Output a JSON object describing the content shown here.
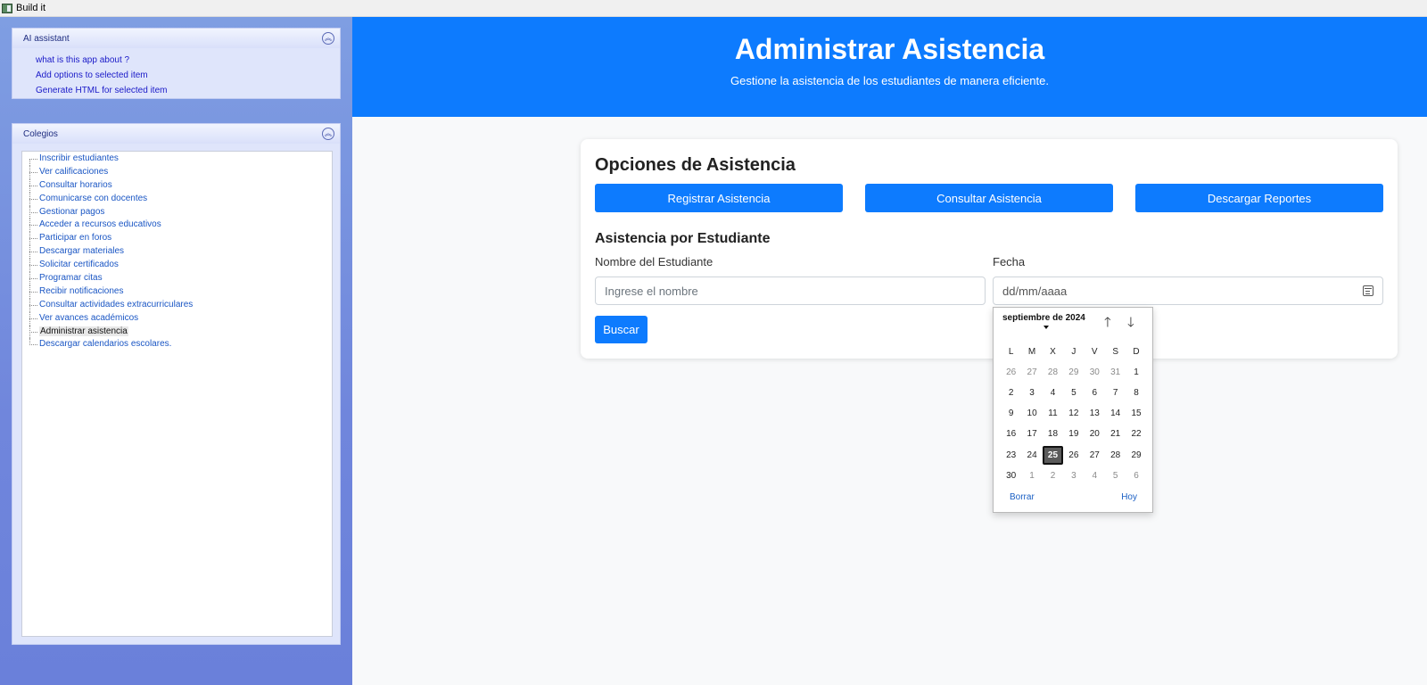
{
  "window": {
    "title": "Build it"
  },
  "ai_assistant": {
    "title": "AI assistant",
    "links": [
      "what is this app about ?",
      "Add options to selected item",
      "Generate HTML for selected item"
    ]
  },
  "colegios": {
    "title": "Colegios",
    "items": [
      "Inscribir estudiantes",
      "Ver calificaciones",
      "Consultar horarios",
      "Comunicarse con docentes",
      "Gestionar pagos",
      "Acceder a recursos educativos",
      "Participar en foros",
      "Descargar materiales",
      "Solicitar certificados",
      "Programar citas",
      "Recibir notificaciones",
      "Consultar actividades extracurriculares",
      "Ver avances académicos",
      "Administrar asistencia",
      "Descargar calendarios escolares."
    ],
    "selected": "Administrar asistencia"
  },
  "header": {
    "title": "Administrar Asistencia",
    "subtitle": "Gestione la asistencia de los estudiantes de manera eficiente."
  },
  "card": {
    "title": "Opciones de Asistencia",
    "buttons": {
      "register": "Registrar Asistencia",
      "consult": "Consultar Asistencia",
      "download": "Descargar Reportes"
    },
    "section_title": "Asistencia por Estudiante",
    "name_label": "Nombre del Estudiante",
    "name_placeholder": "Ingrese el nombre",
    "date_label": "Fecha",
    "date_placeholder": "dd/mm/aaaa",
    "search_button": "Buscar"
  },
  "calendar": {
    "month_label": "septiembre de 2024",
    "weekdays": [
      "L",
      "M",
      "X",
      "J",
      "V",
      "S",
      "D"
    ],
    "weeks": [
      [
        "26",
        "27",
        "28",
        "29",
        "30",
        "31",
        "1"
      ],
      [
        "2",
        "3",
        "4",
        "5",
        "6",
        "7",
        "8"
      ],
      [
        "9",
        "10",
        "11",
        "12",
        "13",
        "14",
        "15"
      ],
      [
        "16",
        "17",
        "18",
        "19",
        "20",
        "21",
        "22"
      ],
      [
        "23",
        "24",
        "25",
        "26",
        "27",
        "28",
        "29"
      ],
      [
        "30",
        "1",
        "2",
        "3",
        "4",
        "5",
        "6"
      ]
    ],
    "selected_day": "25",
    "clear_label": "Borrar",
    "today_label": "Hoy"
  },
  "colors": {
    "primary": "#0d7bfe",
    "panel_gradient_top": "#7f9ee2",
    "panel_gradient_bottom": "#6a80da"
  },
  "icons": {
    "collapse": "chevron-double-up-icon",
    "calendar": "calendar-icon",
    "month_prev": "arrow-up-icon",
    "month_next": "arrow-down-icon"
  }
}
